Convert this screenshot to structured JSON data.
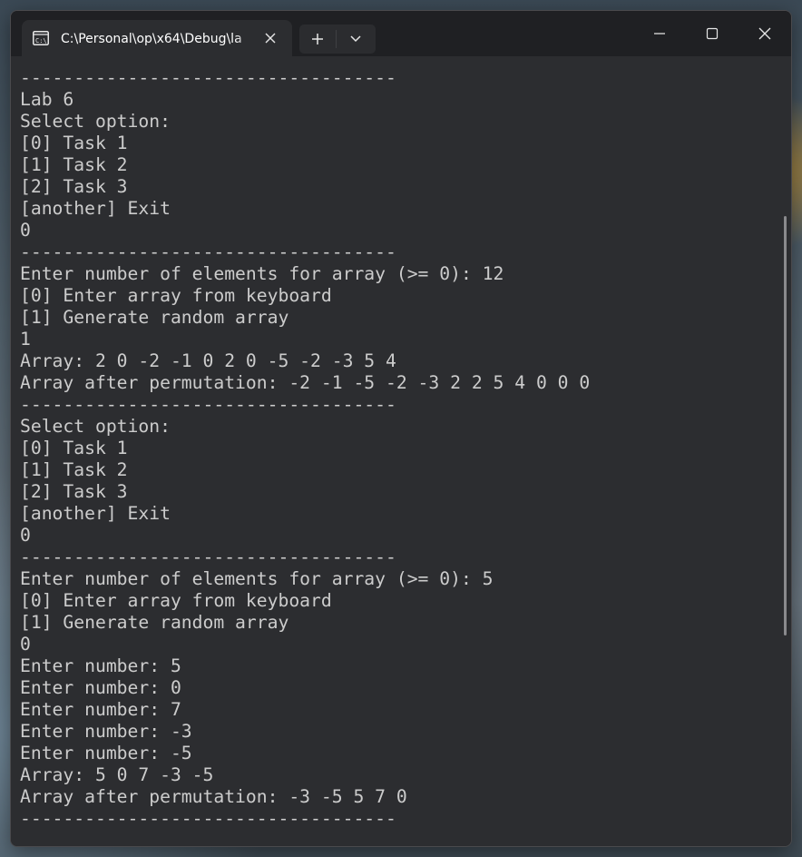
{
  "window": {
    "tab": {
      "title": "C:\\Personal\\op\\x64\\Debug\\la",
      "icon": "terminal-icon",
      "close_icon": "close-icon"
    },
    "new_tab_icon": "plus-icon",
    "dropdown_icon": "chevron-down-icon",
    "controls": [
      "minimize-icon",
      "maximize-icon",
      "close-icon"
    ]
  },
  "colors": {
    "titlebar": "#1f2023",
    "terminal_bg": "#2c2d30",
    "text": "#cccccc"
  },
  "terminal": {
    "lines": [
      "-----------------------------------",
      "Lab 6",
      "Select option:",
      "[0] Task 1",
      "[1] Task 2",
      "[2] Task 3",
      "[another] Exit",
      "0",
      "-----------------------------------",
      "Enter number of elements for array (>= 0): 12",
      "[0] Enter array from keyboard",
      "[1] Generate random array",
      "1",
      "Array: 2 0 -2 -1 0 2 0 -5 -2 -3 5 4",
      "Array after permutation: -2 -1 -5 -2 -3 2 2 5 4 0 0 0",
      "-----------------------------------",
      "Select option:",
      "[0] Task 1",
      "[1] Task 2",
      "[2] Task 3",
      "[another] Exit",
      "0",
      "-----------------------------------",
      "Enter number of elements for array (>= 0): 5",
      "[0] Enter array from keyboard",
      "[1] Generate random array",
      "0",
      "Enter number: 5",
      "Enter number: 0",
      "Enter number: 7",
      "Enter number: -3",
      "Enter number: -5",
      "Array: 5 0 7 -3 -5",
      "Array after permutation: -3 -5 5 7 0",
      "-----------------------------------"
    ]
  }
}
